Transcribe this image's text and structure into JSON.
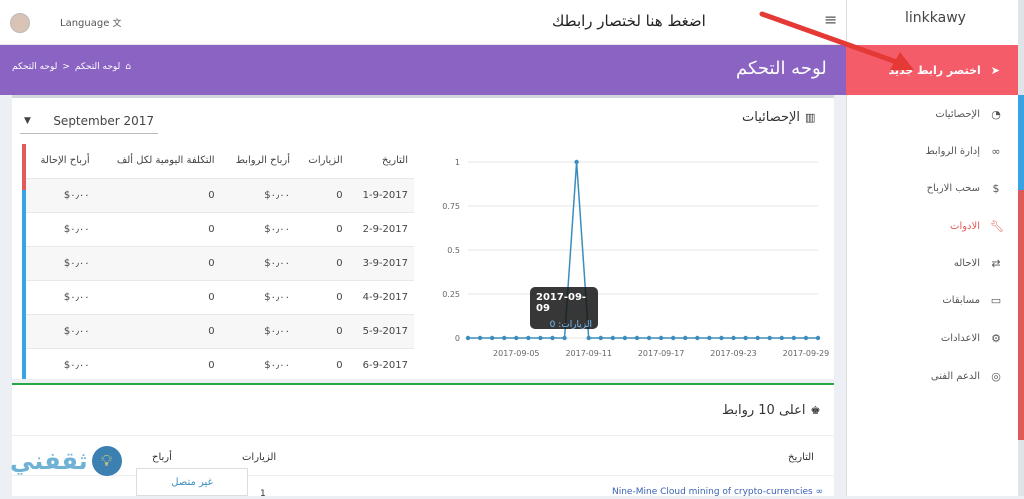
{
  "topbar": {
    "language_label": "Language",
    "annotation": "اضغط هنا لختصار رابطك",
    "brand": "linkkawy"
  },
  "header": {
    "page_title": "لوحه التحكم",
    "breadcrumb": [
      "لوحه التحكم",
      "لوحه التحكم"
    ],
    "breadcrumb_sep": ">"
  },
  "sidebar": {
    "new_link": "اختصر رابط جديد",
    "items": [
      {
        "label": "الإحصائيات",
        "icon": "dashboard-icon"
      },
      {
        "label": "إدارة الروابط",
        "icon": "link-icon"
      },
      {
        "label": "سحب الارباح",
        "icon": "dollar-icon"
      },
      {
        "label": "الادوات",
        "icon": "wrench-icon"
      },
      {
        "label": "الاحاله",
        "icon": "exchange-icon"
      },
      {
        "label": "مسابقات",
        "icon": "card-icon"
      },
      {
        "label": "الاعدادات",
        "icon": "gears-icon"
      },
      {
        "label": "الدعم الفنى",
        "icon": "lifebuoy-icon"
      }
    ]
  },
  "stats": {
    "title": "الإحصائيات",
    "month_select": "September 2017",
    "table": {
      "headers": [
        "التاريخ",
        "الزيارات",
        "أرباح الروابط",
        "التكلفة اليومية لكل ألف",
        "أرباح الإحالة"
      ],
      "rows": [
        [
          "1-9-2017",
          "0",
          "$٠٫٠٠",
          "0",
          "$٠٫٠٠"
        ],
        [
          "2-9-2017",
          "0",
          "$٠٫٠٠",
          "0",
          "$٠٫٠٠"
        ],
        [
          "3-9-2017",
          "0",
          "$٠٫٠٠",
          "0",
          "$٠٫٠٠"
        ],
        [
          "4-9-2017",
          "0",
          "$٠٫٠٠",
          "0",
          "$٠٫٠٠"
        ],
        [
          "5-9-2017",
          "0",
          "$٠٫٠٠",
          "0",
          "$٠٫٠٠"
        ],
        [
          "6-9-2017",
          "0",
          "$٠٫٠٠",
          "0",
          "$٠٫٠٠"
        ]
      ]
    },
    "tooltip": {
      "date": "2017-09-09",
      "label": "الزيارات: 0"
    }
  },
  "chart_data": {
    "type": "line",
    "x_tick_labels": [
      "2017-09-05",
      "2017-09-11",
      "2017-09-17",
      "2017-09-23",
      "2017-09-29"
    ],
    "y_tick_labels": [
      "0",
      "0.25",
      "0.5",
      "0.75",
      "1"
    ],
    "ylim": [
      0,
      1
    ],
    "x_start_day": 1,
    "x_end_day": 30,
    "grid": true,
    "series": [
      {
        "values": [
          0,
          0,
          0,
          0,
          0,
          0,
          0,
          0,
          0,
          1,
          0,
          0,
          0,
          0,
          0,
          0,
          0,
          0,
          0,
          0,
          0,
          0,
          0,
          0,
          0,
          0,
          0,
          0,
          0,
          0
        ],
        "color": "#3c8dbc"
      }
    ]
  },
  "top10": {
    "title": "اعلى 10 روابط",
    "headers": [
      "التاريخ",
      "الزيارات",
      "أرباح"
    ],
    "row": {
      "link": "Nine-Mine Cloud mining of crypto-currencies",
      "visits": "1"
    }
  },
  "chat": {
    "status": "غير متصل"
  },
  "watermark": "ثقفني"
}
